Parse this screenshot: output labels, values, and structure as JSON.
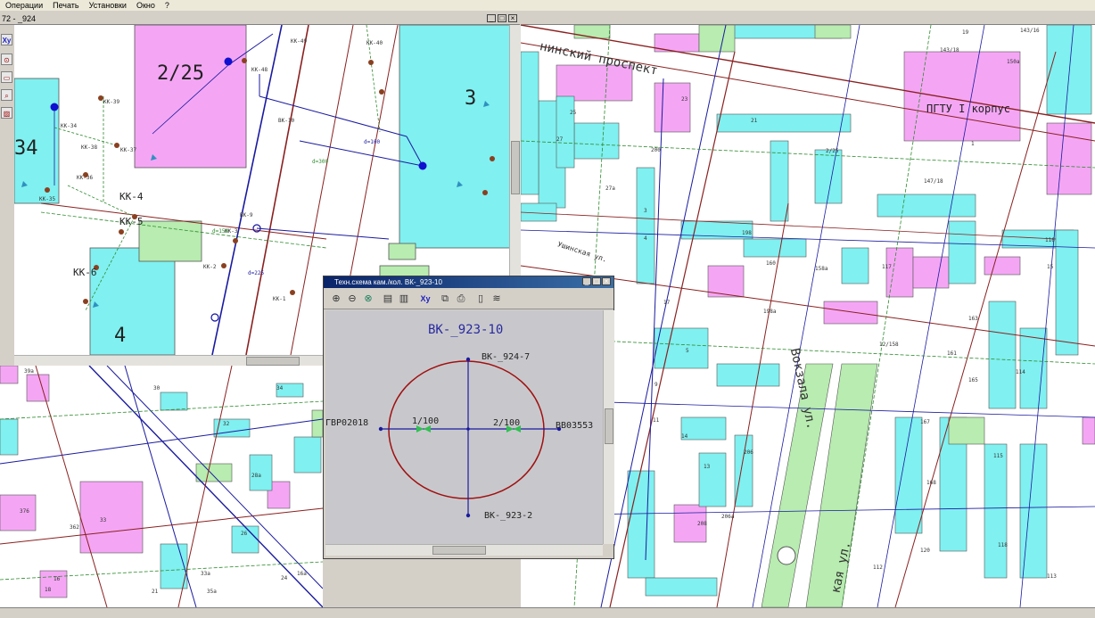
{
  "menu": [
    "Операции",
    "Печать",
    "Установки",
    "Окно",
    "?"
  ],
  "left_window": {
    "title": "72 - _924",
    "buildings": [
      "2/25",
      "3",
      "34",
      "4"
    ],
    "wells": [
      "КК-49",
      "КК-40",
      "КК-48",
      "КК-39",
      "КК-38",
      "КК-37",
      "КК-36",
      "КК-35",
      "КК-34",
      "КК-4",
      "КК-5",
      "КК-6",
      "КК-3",
      "КК-2",
      "КК-1",
      "ВК-10",
      "ВК-9"
    ],
    "pipes": [
      "d=100",
      "d=300",
      "d=225",
      "d=150"
    ]
  },
  "right_map": {
    "streets": [
      "нинский проспект",
      "Ушинская ул.",
      "Вокзала ул.",
      "кая ул."
    ],
    "labels": [
      "ПГТУ I корпус",
      "147/18",
      "12/158",
      "206а",
      "206",
      "208",
      "167",
      "168",
      "161",
      "163",
      "165",
      "118",
      "120",
      "112",
      "113",
      "114",
      "115",
      "116",
      "117",
      "158а",
      "160",
      "198",
      "198а",
      "200",
      "2/25",
      "21",
      "23",
      "25",
      "27",
      "27а",
      "1",
      "3",
      "4",
      "5",
      "9",
      "11",
      "13",
      "14",
      "15",
      "17",
      "19",
      "143/18",
      "143/16",
      "150а",
      "143/14"
    ]
  },
  "bottom_left_map": {
    "labels": [
      "39а",
      "30",
      "34",
      "32",
      "28а",
      "376",
      "26",
      "24",
      "33",
      "33а",
      "35а",
      "16а",
      "16",
      "18",
      "21",
      "362"
    ]
  },
  "popup": {
    "title": "Техн.схема кам./кол. ВК-_923-10",
    "toolbar": [
      "zoom-in",
      "zoom-out",
      "zoom-fit",
      "tile",
      "tile-2",
      "coords",
      "copy",
      "print",
      "preview",
      "settings"
    ],
    "coords_label": "Xy",
    "diagram": {
      "chamber_name": "ВК-_923-10",
      "north_node": "ВК-_924-7",
      "south_node": "ВК-_923-2",
      "west_node": "ГВР02018",
      "east_node": "ВВ03553",
      "west_label": "1/100",
      "east_label": "2/100"
    }
  },
  "colors": {
    "magenta": "#f4a6f4",
    "cyan": "#80f0f0",
    "green": "#b8ecb0",
    "pipe_blue": "#1a1aa0",
    "chamber_red": "#a01010"
  }
}
